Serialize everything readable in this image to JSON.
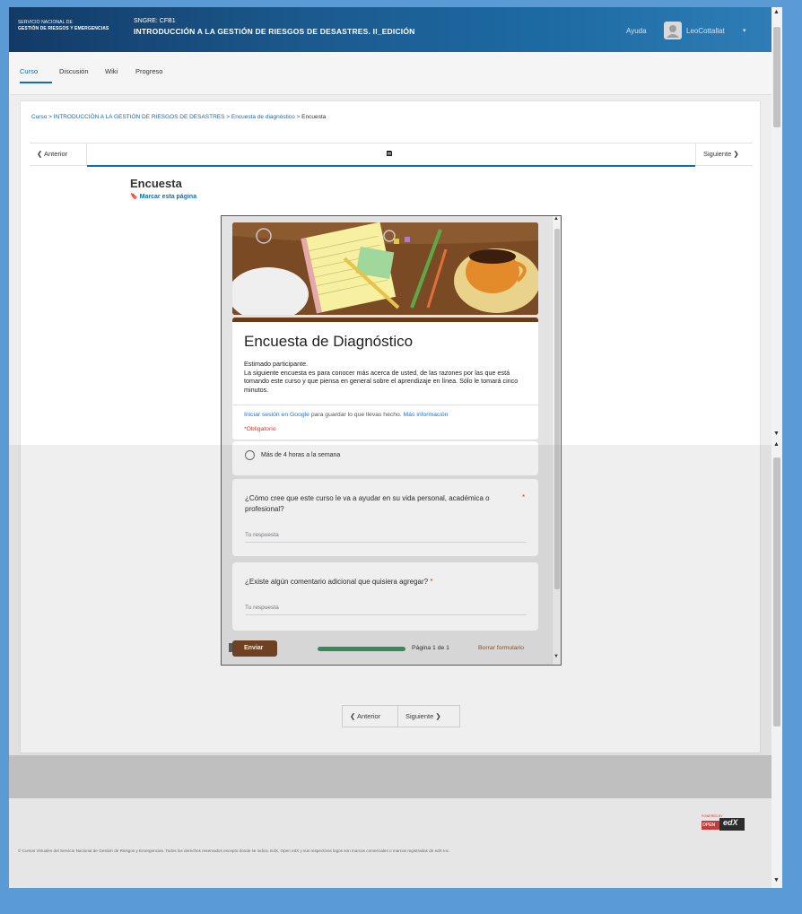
{
  "header": {
    "org_line1": "SERVICIO NACIONAL DE",
    "org_line2": "GESTIÓN DE RIESGOS Y EMERGENCIAS",
    "course_code": "SNGRE: CFB1",
    "course_title": "INTRODUCCIÓN A LA GESTIÓN DE RIESGOS DE DESASTRES. II_EDICIÓN",
    "help_label": "Ayuda",
    "username": "LeoCottallat",
    "user_menu_icon": "chevron-down-icon"
  },
  "nav": {
    "tabs": [
      {
        "label": "Curso",
        "active": true
      },
      {
        "label": "Discusión",
        "active": false
      },
      {
        "label": "Wiki",
        "active": false
      },
      {
        "label": "Progreso",
        "active": false
      }
    ]
  },
  "breadcrumb": {
    "items": [
      "Curso",
      "INTRODUCCIÓN A LA GESTIÓN DE RIESGOS DE DESASTRES",
      "Encuesta de diagnóstico"
    ],
    "current": "Encuesta",
    "separator": ">"
  },
  "sequence_nav": {
    "prev_label": "Anterior",
    "next_label": "Siguiente",
    "unit_icon": "document-icon"
  },
  "unit": {
    "title": "Encuesta",
    "bookmark_label": "Marcar esta página"
  },
  "form": {
    "title": "Encuesta de Diagnóstico",
    "description_line1": "Estimado participante.",
    "description_line2": "La siguiente encuesta es para conocer más acerca de usted, de las razones por las que está tomando este curso y que piensa en general sobre el aprendizaje en línea. Sólo le tomará cinco minutos.",
    "signin_link": "Iniciar sesión en Google",
    "signin_text": "para guardar lo que llevas hecho.",
    "more_info_link": "Más información",
    "required_note": "*Obligatorio",
    "radio_option": "Más de 4 horas a la semana",
    "question1": "¿Cómo cree que este curso le va a ayudar en su vida personal, académica o profesional?",
    "question1_required": "*",
    "question2": "¿Existe algún comentario adicional que quisiera agregar?",
    "question2_required": "*",
    "answer_placeholder": "Tu respuesta",
    "submit_label": "Enviar",
    "page_label": "Página 1 de 1",
    "progress": 1.0,
    "clear_label": "Borrar formulario",
    "accent_color": "#6b3a16"
  },
  "bottom_nav": {
    "prev_label": "Anterior",
    "next_label": "Siguiente"
  },
  "footer": {
    "copyright": "© Cursos Virtuales del Servicio Nacional de Gestión de Riesgos y Emergencias. Todos los derechos reservados excepto donde se indica. EdX, Open edX y sus respectivos logos son marcas comerciales o marcas registradas de edX Inc.",
    "logo_badge": "OPEN",
    "logo_text": "edX",
    "logo_powered": "POWERED BY"
  },
  "colors": {
    "brand_blue": "#1b5a8f",
    "link_blue": "#0a6ebd",
    "background": "#5b9bd5"
  }
}
